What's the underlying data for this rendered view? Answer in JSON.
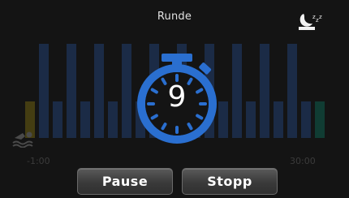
{
  "header": {
    "title": "Runde"
  },
  "icons": {
    "sleep": "sleep-moon-icon",
    "swim": "swimmer-icon",
    "timer": "stopwatch-icon"
  },
  "timer": {
    "value": "9"
  },
  "chart_data": {
    "type": "bar",
    "x_start_label": "-1:00",
    "x_end_label": "30:00",
    "bar_count": 22,
    "series": [
      {
        "values": [
          0.37,
          0.95,
          0.37,
          0.95,
          0.37,
          0.95,
          0.37,
          0.95,
          0.37,
          0.95,
          0.37,
          0.95,
          0.37,
          0.95,
          0.37,
          0.95,
          0.37,
          0.95,
          0.37,
          0.95,
          0.37,
          0.37
        ]
      }
    ],
    "colors": {
      "bar": "#1b2b46",
      "first_bar": "#443d12",
      "last_bar": "#103c33"
    },
    "ylim": [
      0,
      1
    ]
  },
  "buttons": {
    "pause": "Pause",
    "stop": "Stopp"
  },
  "colors": {
    "accent": "#2a6fd0",
    "background": "#141414"
  }
}
